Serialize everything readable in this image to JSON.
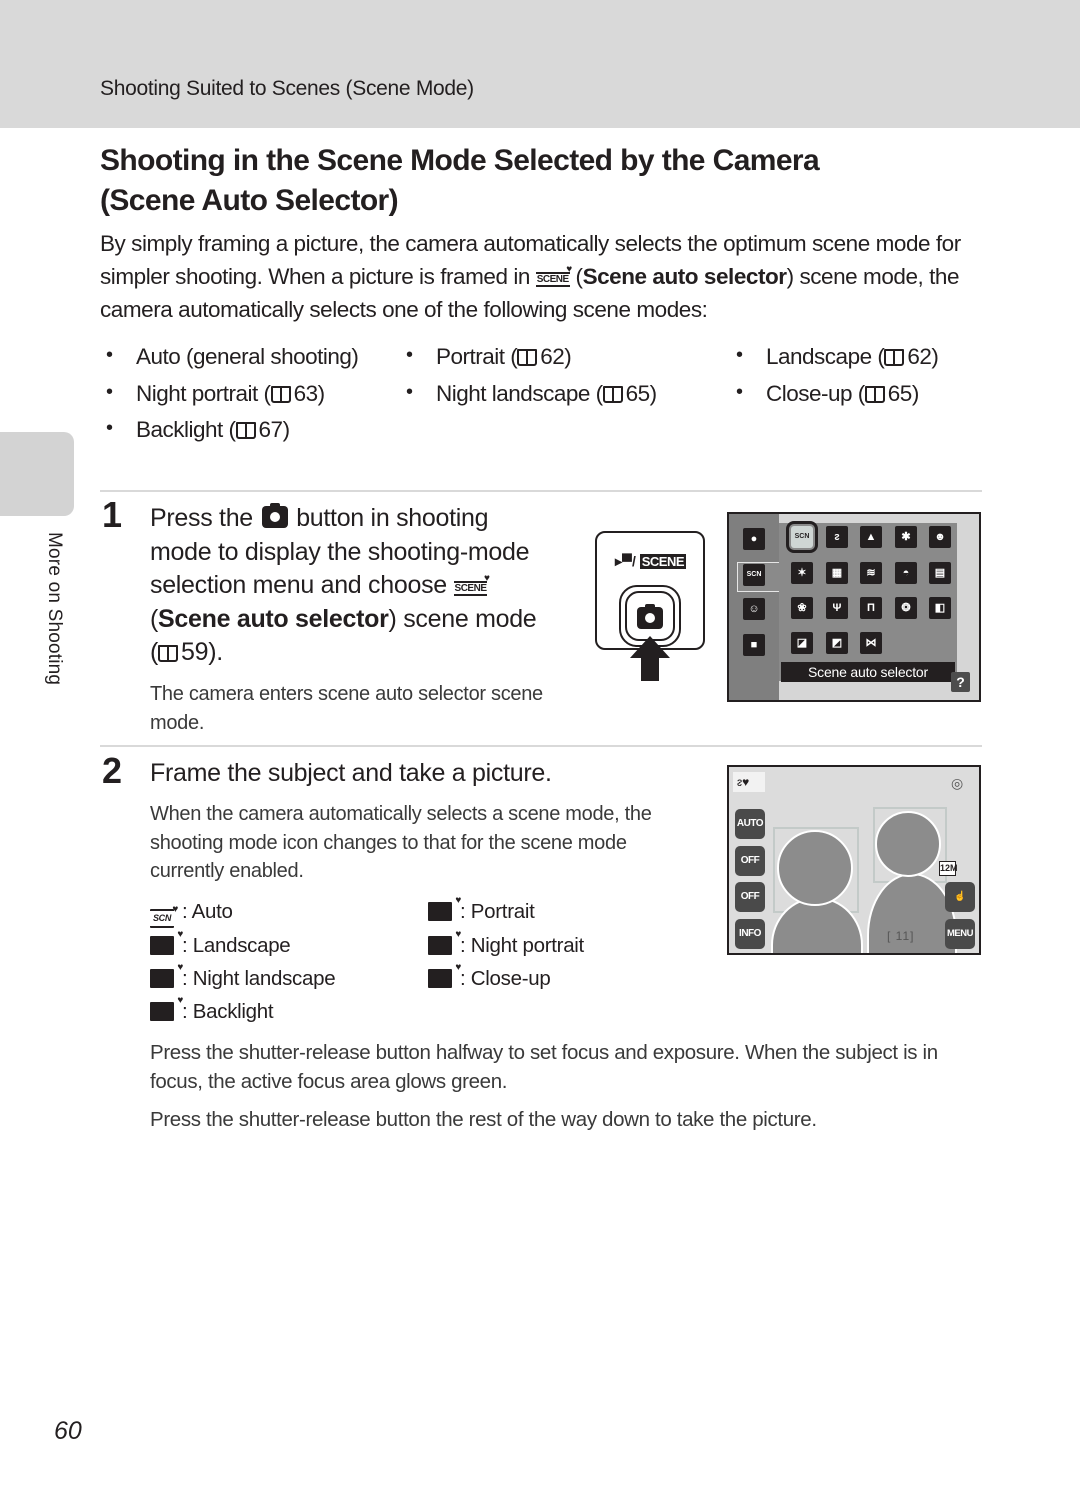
{
  "running_head": "Shooting Suited to Scenes (Scene Mode)",
  "title_line1": "Shooting in the Scene Mode Selected by the Camera",
  "title_line2": "(Scene Auto Selector)",
  "intro": {
    "part1": "By simply framing a picture, the camera automatically selects the optimum scene mode for simpler shooting. When a picture is framed in ",
    "icon": "scene-auto-icon",
    "bold": "Scene auto selector",
    "part2": ") scene mode, the camera automatically selects one of the following scene modes:"
  },
  "scene_modes": [
    {
      "label": "Auto (general shooting)",
      "page": ""
    },
    {
      "label": "Portrait (",
      "page": "62)"
    },
    {
      "label": "Landscape (",
      "page": "62)"
    },
    {
      "label": "Night portrait (",
      "page": "63)"
    },
    {
      "label": "Night landscape (",
      "page": "65)"
    },
    {
      "label": "Close-up (",
      "page": "65)"
    },
    {
      "label": "Backlight (",
      "page": "67)"
    }
  ],
  "step1": {
    "number": "1",
    "line1_a": "Press the ",
    "line1_b": " button in shooting",
    "line2": "mode to display the shooting-mode",
    "line3": "selection menu and choose ",
    "line4_bold": "Scene auto selector",
    "line4_rest": ") scene mode",
    "line5_page": "59).",
    "note": "The camera enters scene auto selector scene mode.",
    "button_label_movie": "▸",
    "button_label_scene": "SCENE",
    "menu_caption": "Scene auto selector",
    "menu_help": "?",
    "menu_left_icons": [
      "shooting-mode-icon",
      "scene-icon",
      "smart-portrait-icon",
      "movie-icon"
    ],
    "menu_grid_icons": [
      [
        "scene-auto-selector-icon",
        "portrait-icon",
        "landscape-icon",
        "sports-icon",
        "night-portrait-icon"
      ],
      [
        "party-indoor-icon",
        "beach-icon",
        "snow-icon",
        "sunset-icon",
        "dusk-dawn-icon"
      ],
      [
        "close-up-icon",
        "food-icon",
        "museum-icon",
        "fireworks-icon",
        "copy-icon"
      ],
      [
        "backlight-icon",
        "backlight-hdr-icon",
        "panorama-icon"
      ]
    ]
  },
  "step2": {
    "number": "2",
    "title": "Frame the subject and take a picture.",
    "note": "When the camera automatically selects a scene mode, the shooting mode icon changes to that for the scene mode currently enabled.",
    "screen": {
      "flash": "AUTO",
      "self_timer": "OFF",
      "macro": "OFF",
      "info": "INFO",
      "menu": "MENU",
      "image_size": "12M",
      "exposures_remaining": "[ 11]"
    }
  },
  "icon_legend": [
    {
      "icon": "scene-auto-icon",
      "label": ": Auto"
    },
    {
      "icon": "portrait-auto-icon",
      "label": ": Portrait"
    },
    {
      "icon": "landscape-auto-icon",
      "label": ": Landscape"
    },
    {
      "icon": "night-portrait-auto-icon",
      "label": ": Night portrait"
    },
    {
      "icon": "night-landscape-auto-icon",
      "label": ": Night landscape"
    },
    {
      "icon": "close-up-auto-icon",
      "label": ": Close-up"
    },
    {
      "icon": "backlight-auto-icon",
      "label": ": Backlight"
    }
  ],
  "para1": "Press the shutter-release button halfway to set focus and exposure. When the subject is in focus, the active focus area glows green.",
  "para2": "Press the shutter-release button the rest of the way down to take the picture.",
  "side_label": "More on Shooting",
  "page_number": "60"
}
